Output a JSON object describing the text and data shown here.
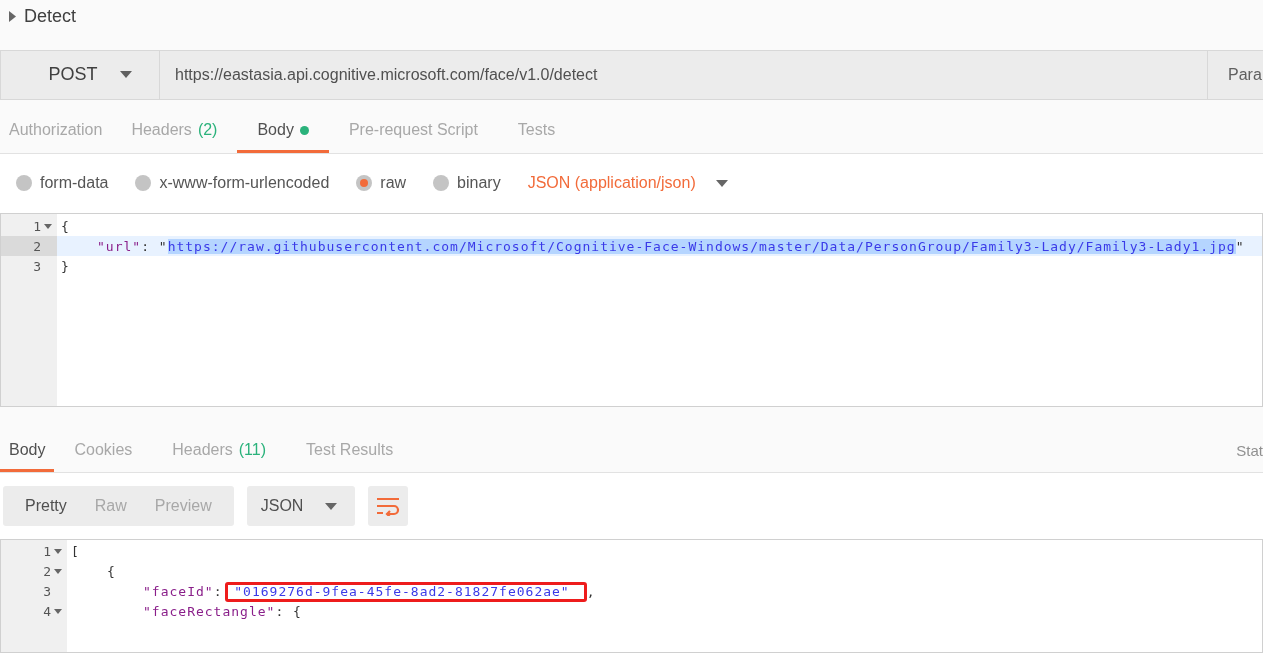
{
  "request_title": "Detect",
  "request": {
    "method": "POST",
    "url": "https://eastasia.api.cognitive.microsoft.com/face/v1.0/detect",
    "params_button": "Para"
  },
  "request_tabs": [
    {
      "label": "Authorization",
      "selected": false
    },
    {
      "label": "Headers",
      "count": "(2)",
      "selected": false
    },
    {
      "label": "Body",
      "selected": true,
      "has_content": true
    },
    {
      "label": "Pre-request Script",
      "selected": false
    },
    {
      "label": "Tests",
      "selected": false
    }
  ],
  "body_types": [
    {
      "label": "form-data",
      "selected": false
    },
    {
      "label": "x-www-form-urlencoded",
      "selected": false
    },
    {
      "label": "raw",
      "selected": true
    },
    {
      "label": "binary",
      "selected": false
    }
  ],
  "body_format": "JSON (application/json)",
  "request_body": {
    "lines": [
      {
        "number": "1",
        "fold": true,
        "active": false,
        "tokens": [
          {
            "kind": "punct",
            "text": "{"
          }
        ]
      },
      {
        "number": "2",
        "fold": false,
        "active": true,
        "tokens": [
          {
            "kind": "key",
            "text": "\"url\""
          },
          {
            "kind": "punct",
            "text": ": \""
          },
          {
            "kind": "string",
            "text": "https://raw.githubusercontent.com/Microsoft/Cognitive-Face-Windows/master/Data/PersonGroup/Family3-Lady/Family3-Lady1.jpg",
            "selected": true
          },
          {
            "kind": "punct",
            "text": "\""
          }
        ]
      },
      {
        "number": "3",
        "fold": false,
        "active": false,
        "tokens": [
          {
            "kind": "punct",
            "text": "}"
          }
        ]
      }
    ]
  },
  "response_tabs": [
    {
      "label": "Body",
      "selected": true
    },
    {
      "label": "Cookies",
      "selected": false
    },
    {
      "label": "Headers",
      "count": "(11)",
      "selected": false
    },
    {
      "label": "Test Results",
      "selected": false
    }
  ],
  "status_label": "Stat",
  "view_modes": [
    {
      "label": "Pretty",
      "selected": true
    },
    {
      "label": "Raw",
      "selected": false
    },
    {
      "label": "Preview",
      "selected": false
    }
  ],
  "response_format": "JSON",
  "response_body": {
    "lines": [
      {
        "number": "1",
        "fold": true,
        "active": false,
        "tokens": [
          {
            "kind": "punct",
            "text": "["
          }
        ]
      },
      {
        "number": "2",
        "fold": true,
        "active": false,
        "tokens": [
          {
            "kind": "punct",
            "text": "{"
          }
        ]
      },
      {
        "number": "3",
        "fold": false,
        "active": false,
        "tokens": [
          {
            "kind": "key",
            "text": "\"faceId\""
          },
          {
            "kind": "punct",
            "text": ":"
          },
          {
            "kind": "string",
            "text": "\"0169276d-9fea-45fe-8ad2-81827fe062ae\"",
            "selected": false,
            "boxed": true
          },
          {
            "kind": "punct",
            "text": ","
          }
        ]
      },
      {
        "number": "4",
        "fold": true,
        "active": false,
        "tokens": [
          {
            "kind": "key",
            "text": "\"faceRectangle\""
          },
          {
            "kind": "punct",
            "text": ": {"
          }
        ]
      }
    ]
  }
}
